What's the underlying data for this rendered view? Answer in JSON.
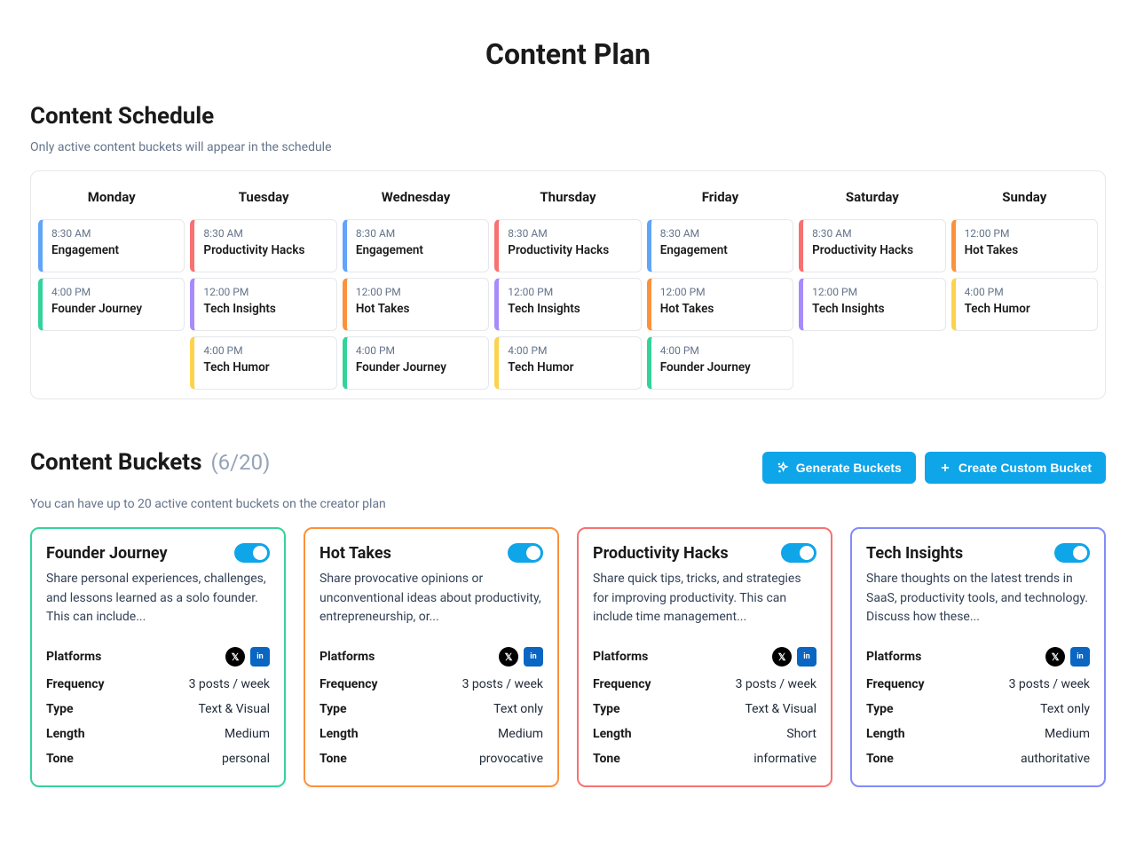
{
  "title": "Content Plan",
  "schedule": {
    "heading": "Content Schedule",
    "helper": "Only active content buckets will appear in the schedule",
    "days": [
      "Monday",
      "Tuesday",
      "Wednesday",
      "Thursday",
      "Friday",
      "Saturday",
      "Sunday"
    ],
    "grid": [
      [
        {
          "time": "8:30 AM",
          "label": "Engagement",
          "color": "blue"
        },
        {
          "time": "4:00 PM",
          "label": "Founder Journey",
          "color": "green"
        }
      ],
      [
        {
          "time": "8:30 AM",
          "label": "Productivity Hacks",
          "color": "red"
        },
        {
          "time": "12:00 PM",
          "label": "Tech Insights",
          "color": "purple"
        },
        {
          "time": "4:00 PM",
          "label": "Tech Humor",
          "color": "yellow"
        }
      ],
      [
        {
          "time": "8:30 AM",
          "label": "Engagement",
          "color": "blue"
        },
        {
          "time": "12:00 PM",
          "label": "Hot Takes",
          "color": "orange"
        },
        {
          "time": "4:00 PM",
          "label": "Founder Journey",
          "color": "green"
        }
      ],
      [
        {
          "time": "8:30 AM",
          "label": "Productivity Hacks",
          "color": "red"
        },
        {
          "time": "12:00 PM",
          "label": "Tech Insights",
          "color": "purple"
        },
        {
          "time": "4:00 PM",
          "label": "Tech Humor",
          "color": "yellow"
        }
      ],
      [
        {
          "time": "8:30 AM",
          "label": "Engagement",
          "color": "blue"
        },
        {
          "time": "12:00 PM",
          "label": "Hot Takes",
          "color": "orange"
        },
        {
          "time": "4:00 PM",
          "label": "Founder Journey",
          "color": "green"
        }
      ],
      [
        {
          "time": "8:30 AM",
          "label": "Productivity Hacks",
          "color": "red"
        },
        {
          "time": "12:00 PM",
          "label": "Tech Insights",
          "color": "purple"
        }
      ],
      [
        {
          "time": "12:00 PM",
          "label": "Hot Takes",
          "color": "orange"
        },
        {
          "time": "4:00 PM",
          "label": "Tech Humor",
          "color": "yellow"
        }
      ]
    ]
  },
  "buckets_section": {
    "heading": "Content Buckets",
    "count": "(6/20)",
    "helper": "You can have up to 20 active content buckets on the creator plan",
    "generate_label": "Generate Buckets",
    "create_label": "Create Custom Bucket"
  },
  "meta_keys": {
    "platforms": "Platforms",
    "frequency": "Frequency",
    "type": "Type",
    "length": "Length",
    "tone": "Tone"
  },
  "buckets": [
    {
      "title": "Founder Journey",
      "color": "green",
      "desc": "Share personal experiences, challenges, and lessons learned as a solo founder. This can include...",
      "platforms": [
        "x",
        "linkedin"
      ],
      "frequency": "3 posts / week",
      "type": "Text & Visual",
      "length": "Medium",
      "tone": "personal",
      "active": true
    },
    {
      "title": "Hot Takes",
      "color": "orange",
      "desc": "Share provocative opinions or unconventional ideas about productivity, entrepreneurship, or...",
      "platforms": [
        "x",
        "linkedin"
      ],
      "frequency": "3 posts / week",
      "type": "Text only",
      "length": "Medium",
      "tone": "provocative",
      "active": true
    },
    {
      "title": "Productivity Hacks",
      "color": "red",
      "desc": "Share quick tips, tricks, and strategies for improving productivity. This can include time management...",
      "platforms": [
        "x",
        "linkedin"
      ],
      "frequency": "3 posts / week",
      "type": "Text & Visual",
      "length": "Short",
      "tone": "informative",
      "active": true
    },
    {
      "title": "Tech Insights",
      "color": "purple",
      "desc": "Share thoughts on the latest trends in SaaS, productivity tools, and technology. Discuss how these...",
      "platforms": [
        "x",
        "linkedin"
      ],
      "frequency": "3 posts / week",
      "type": "Text only",
      "length": "Medium",
      "tone": "authoritative",
      "active": true
    }
  ]
}
